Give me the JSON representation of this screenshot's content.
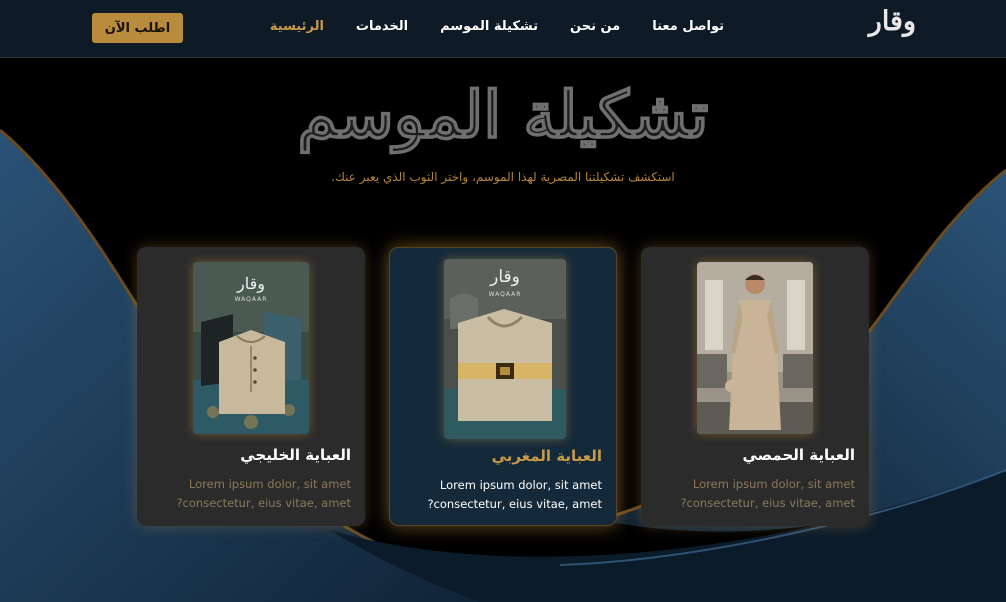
{
  "nav": {
    "logo": "وقار",
    "order_button": "اطلب الآن",
    "items": [
      {
        "label": "الرئيسية",
        "active": true
      },
      {
        "label": "الخدمات",
        "active": false
      },
      {
        "label": "تشكيلة الموسم",
        "active": false
      },
      {
        "label": "من نحن",
        "active": false
      },
      {
        "label": "تواصل معنا",
        "active": false
      }
    ]
  },
  "hero": {
    "title": "تشكيلة الموسم",
    "subtitle": "استكشف تشكيلتنا المصرية لهذا الموسم، واختر الثوب الذي يعبر عنك."
  },
  "cards": [
    {
      "title": "العباية الخليجي",
      "line1": "Lorem ipsum dolor, sit amet",
      "line2": "?consectetur, eius vitae, amet",
      "brand": "وقار",
      "brand_latin": "WAQAAR"
    },
    {
      "title": "العباية المغربي",
      "line1": "Lorem ipsum dolor, sit amet",
      "line2": "?consectetur, eius vitae, amet",
      "brand": "وقار",
      "brand_latin": "WAQAAR"
    },
    {
      "title": "العباية الحمصي",
      "line1": "Lorem ipsum dolor, sit amet",
      "line2": "?consectetur, eius vitae, amet"
    }
  ],
  "colors": {
    "accent": "#c79a4a",
    "button": "#b98b3c",
    "navbar": "#0e1b26",
    "card": "#2b2b2b",
    "card_featured": "#142a3b",
    "wave": "#1d3a55"
  }
}
